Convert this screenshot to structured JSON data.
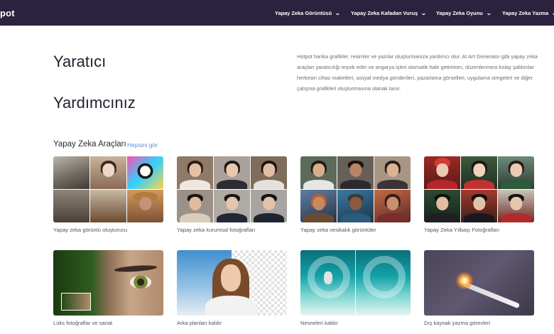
{
  "header": {
    "brand": "pot",
    "nav": [
      {
        "label": "Yapay Zeka Görüntüsü"
      },
      {
        "label": "Yapay Zeka Kafadan Vuruş"
      },
      {
        "label": "Yapay Zeka Oyunu"
      },
      {
        "label": "Yapay Zeka Yazma"
      }
    ]
  },
  "hero": {
    "title_line1": "Yaratıcı",
    "title_line2": "Yardımcınız",
    "description": "Hotpot harika grafikler, resimler ve yazılar oluşturmanıza yardımcı olur. AI Art Generator gibi yapay zeka araçları yaratıcılığı teşvik eder ve angarya işleri otomatik hale getirirken, düzenlenmesi kolay şablonlar herkesin cihaz maketleri, sosyal medya gönderileri, pazarlama görselleri, uygulama simgeleri ve diğer çalışma grafikleri oluşturmasına olanak tanır."
  },
  "tools": {
    "title": "Yapay Zeka Araçları",
    "see_all": "Hepsini gör",
    "cards": [
      {
        "caption": "Yapay zeka görüntü oluşturucu"
      },
      {
        "caption": "Yapay zeka kurumsal fotoğrafları"
      },
      {
        "caption": "Yapay zeka vesikalık görüntüler"
      },
      {
        "caption": "Yapay Zeka Yılbaşı Fotoğrafları"
      },
      {
        "caption": "Lüks fotoğraflar ve sanat"
      },
      {
        "caption": "Arka planları kaldır"
      },
      {
        "caption": "Nesneleri kaldır"
      },
      {
        "caption": "Dış kaynak yazma görevleri"
      }
    ]
  },
  "icons": {
    "chevron": "chevron-down-icon"
  }
}
